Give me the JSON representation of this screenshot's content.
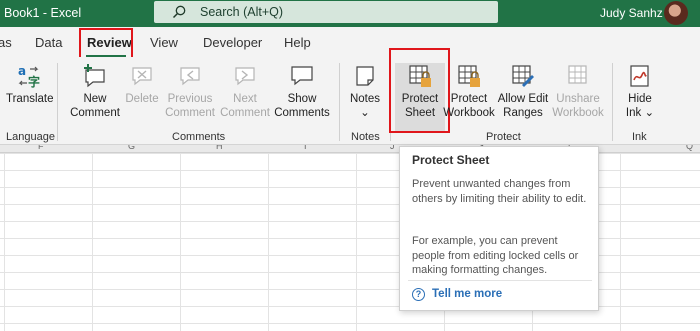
{
  "window": {
    "title": "Book1  -  Excel",
    "user": "Judy Sanhz"
  },
  "search": {
    "placeholder": "Search (Alt+Q)"
  },
  "tabs": [
    {
      "label": "as"
    },
    {
      "label": "Data"
    },
    {
      "label": "Review",
      "active": true
    },
    {
      "label": "View"
    },
    {
      "label": "Developer"
    },
    {
      "label": "Help"
    }
  ],
  "ribbon": {
    "language": {
      "group": "Language",
      "translate": "Translate"
    },
    "comments": {
      "group": "Comments",
      "new_1": "New",
      "new_2": "Comment",
      "delete": "Delete",
      "prev_1": "Previous",
      "prev_2": "Comment",
      "next_1": "Next",
      "next_2": "Comment",
      "show_1": "Show",
      "show_2": "Comments"
    },
    "notes": {
      "group": "Notes",
      "label": "Notes",
      "chevron": "⌄"
    },
    "protect": {
      "group": "Protect",
      "sheet_1": "Protect",
      "sheet_2": "Sheet",
      "workbook_1": "Protect",
      "workbook_2": "Workbook",
      "ranges_1": "Allow Edit",
      "ranges_2": "Ranges",
      "unshare_1": "Unshare",
      "unshare_2": "Workbook"
    },
    "ink": {
      "group": "Ink",
      "hide_1": "Hide",
      "hide_2": "Ink ⌄"
    }
  },
  "columns": [
    "F",
    "G",
    "H",
    "I",
    "J",
    "K",
    "L",
    "Q"
  ],
  "tooltip": {
    "title": "Protect Sheet",
    "para1": "Prevent unwanted changes from others by limiting their ability to edit.",
    "para2": "For example, you can prevent people from editing locked cells or making formatting changes.",
    "link": "Tell me more"
  },
  "colors": {
    "accent": "#217346",
    "highlight": "#e0161b",
    "link": "#2b6fb6"
  }
}
